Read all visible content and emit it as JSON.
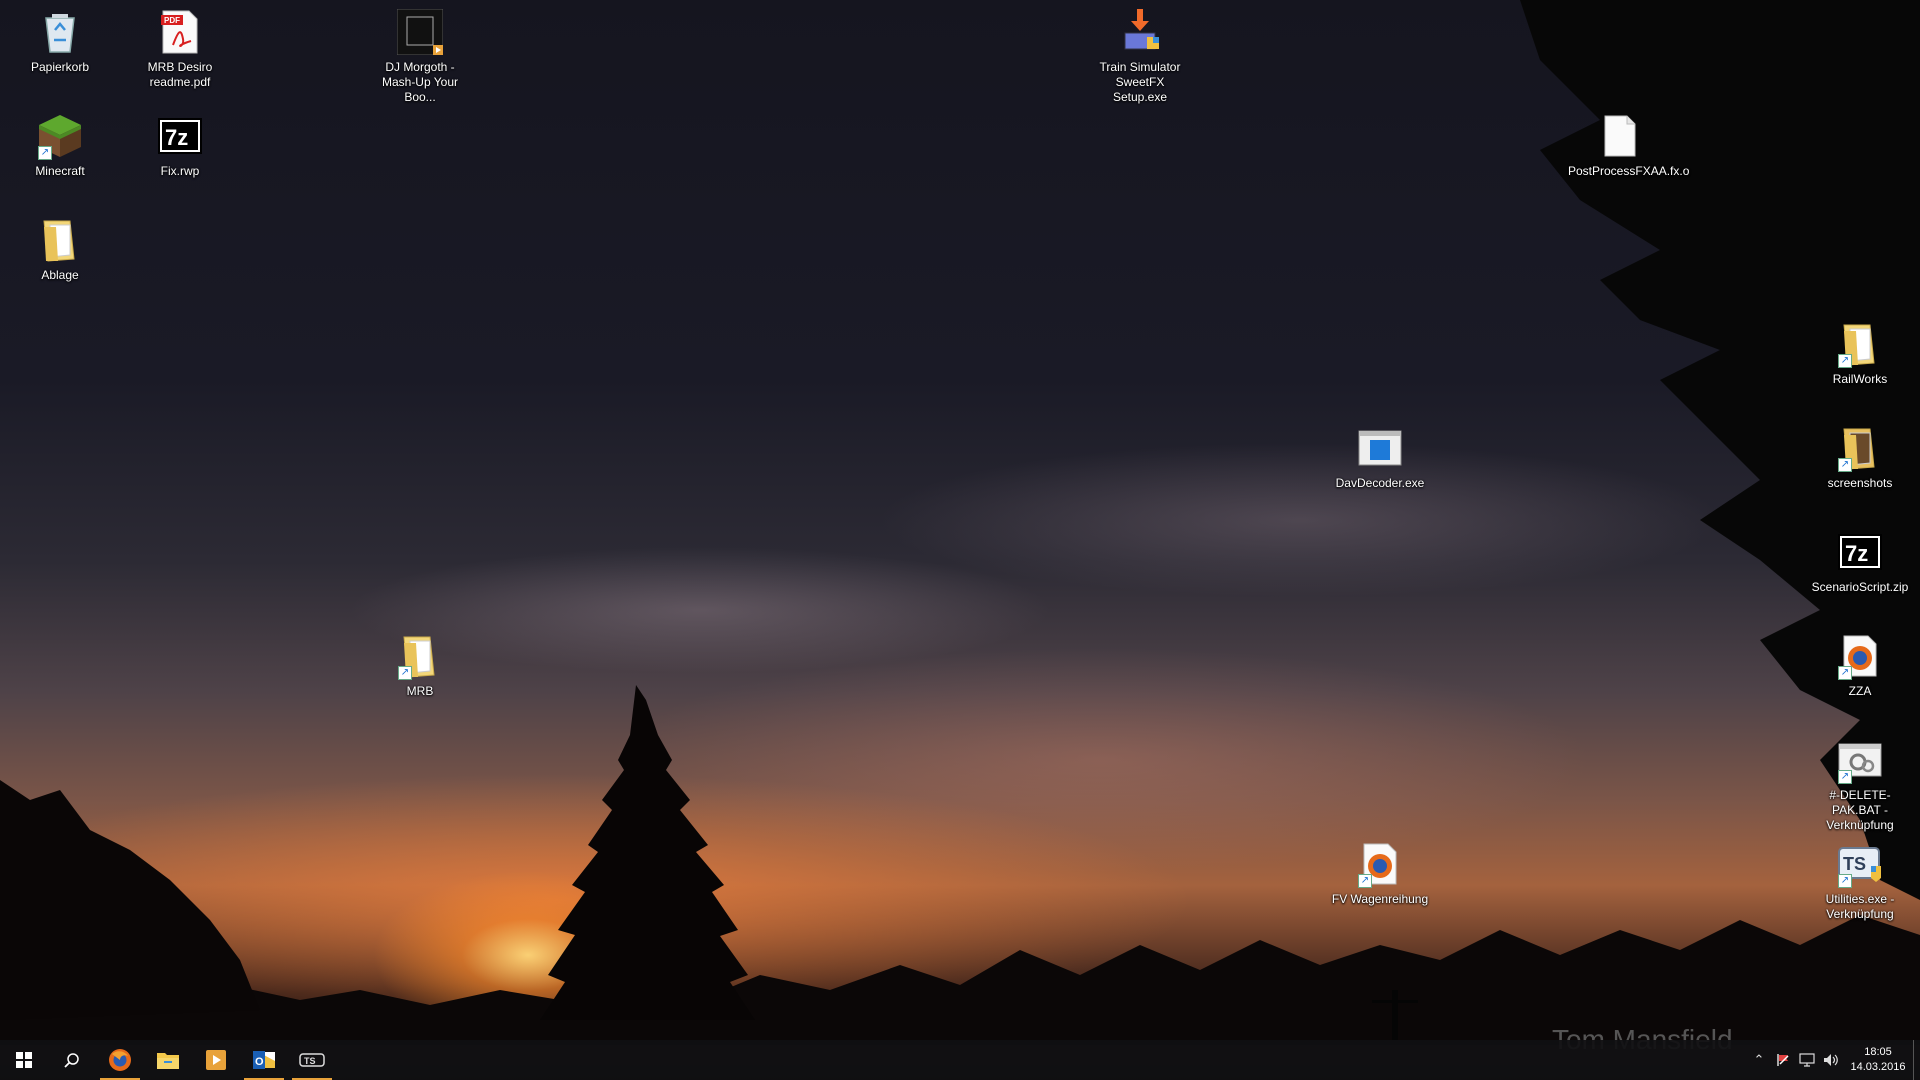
{
  "desktop": {
    "icons": [
      {
        "label": "Papierkorb",
        "icon": "recycle-bin-icon"
      },
      {
        "label": "MRB Desiro readme.pdf",
        "icon": "pdf-icon"
      },
      {
        "label": "DJ Morgoth - Mash-Up Your Boo...",
        "icon": "album-art-icon"
      },
      {
        "label": "Train Simulator SweetFX Setup.exe",
        "icon": "installer-icon"
      },
      {
        "label": "Minecraft",
        "icon": "minecraft-icon"
      },
      {
        "label": "Fix.rwp",
        "icon": "7zip-icon"
      },
      {
        "label": "Ablage",
        "icon": "folder-icon"
      },
      {
        "label": "PostProcessFXAA.fx.o",
        "icon": "blank-file-icon"
      },
      {
        "label": "RailWorks",
        "icon": "folder-icon"
      },
      {
        "label": "DavDecoder.exe",
        "icon": "application-window-icon"
      },
      {
        "label": "screenshots",
        "icon": "folder-icon"
      },
      {
        "label": "ScenarioScript.zip",
        "icon": "7zip-icon"
      },
      {
        "label": "MRB",
        "icon": "folder-icon"
      },
      {
        "label": "ZZA",
        "icon": "firefox-icon"
      },
      {
        "label": "#-DELETE-PAK.BAT - Verknüpfung",
        "icon": "batch-file-icon"
      },
      {
        "label": "FV Wagenreihung",
        "icon": "firefox-document-icon"
      },
      {
        "label": "Utilities.exe - Verknüpfung",
        "icon": "ts-utilities-icon"
      }
    ],
    "watermark": "Tom Mansfield"
  },
  "taskbar": {
    "buttons": [
      {
        "name": "start-icon"
      },
      {
        "name": "search-icon"
      },
      {
        "name": "firefox-icon",
        "active": true
      },
      {
        "name": "file-explorer-icon"
      },
      {
        "name": "media-player-icon"
      },
      {
        "name": "outlook-icon",
        "active": true
      },
      {
        "name": "ts-app-icon",
        "active": true
      }
    ],
    "tray": {
      "clock_time": "18:05",
      "clock_date": "14.03.2016"
    }
  },
  "colors": {
    "active_indicator": "#e8a23a",
    "taskbar_bg": "#101012"
  }
}
